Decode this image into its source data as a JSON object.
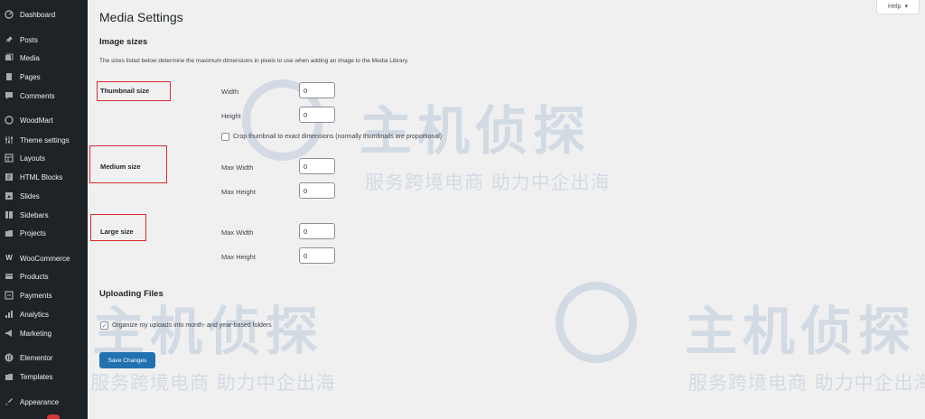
{
  "sidebar": {
    "items": [
      {
        "label": "Dashboard",
        "icon": "dashboard-icon"
      },
      {
        "label": "Posts",
        "icon": "pin-icon"
      },
      {
        "label": "Media",
        "icon": "media-icon"
      },
      {
        "label": "Pages",
        "icon": "pages-icon"
      },
      {
        "label": "Comments",
        "icon": "comment-icon"
      },
      {
        "label": "WoodMart",
        "icon": "woodmart-icon"
      },
      {
        "label": "Theme settings",
        "icon": "sliders-icon"
      },
      {
        "label": "Layouts",
        "icon": "layout-icon"
      },
      {
        "label": "HTML Blocks",
        "icon": "html-blocks-icon"
      },
      {
        "label": "Slides",
        "icon": "slides-icon"
      },
      {
        "label": "Sidebars",
        "icon": "sidebars-icon"
      },
      {
        "label": "Projects",
        "icon": "projects-icon"
      },
      {
        "label": "WooCommerce",
        "icon": "woocommerce-icon"
      },
      {
        "label": "Products",
        "icon": "products-icon"
      },
      {
        "label": "Payments",
        "icon": "payments-icon"
      },
      {
        "label": "Analytics",
        "icon": "analytics-icon"
      },
      {
        "label": "Marketing",
        "icon": "marketing-icon"
      },
      {
        "label": "Elementor",
        "icon": "elementor-icon"
      },
      {
        "label": "Templates",
        "icon": "templates-icon"
      },
      {
        "label": "Appearance",
        "icon": "appearance-icon"
      }
    ]
  },
  "header": {
    "title": "Media Settings",
    "help_label": "Help",
    "help_arrow": "▾"
  },
  "image_sizes": {
    "heading": "Image sizes",
    "description": "The sizes listed below determine the maximum dimensions in pixels to use when adding an image to the Media Library.",
    "thumbnail": {
      "label": "Thumbnail size",
      "width_label": "Width",
      "width_value": "0",
      "height_label": "Height",
      "height_value": "0",
      "crop_label": "Crop thumbnail to exact dimensions (normally thumbnails are proportional)",
      "crop_checked": false
    },
    "medium": {
      "label": "Medium size",
      "max_width_label": "Max Width",
      "max_width_value": "0",
      "max_height_label": "Max Height",
      "max_height_value": "0"
    },
    "large": {
      "label": "Large size",
      "max_width_label": "Max Width",
      "max_width_value": "0",
      "max_height_label": "Max Height",
      "max_height_value": "0"
    }
  },
  "uploading": {
    "heading": "Uploading Files",
    "organize_label": "Organize my uploads into month- and year-based folders",
    "organize_checked": true,
    "check_mark": "✓"
  },
  "actions": {
    "save_label": "Save Changes"
  },
  "watermark": {
    "brand": "主机侦探",
    "slogan": "服务跨境电商 助力中企出海"
  },
  "colors": {
    "sidebar_bg": "#1d2327",
    "primary": "#2271b1",
    "highlight_box": "#d92b2b"
  }
}
